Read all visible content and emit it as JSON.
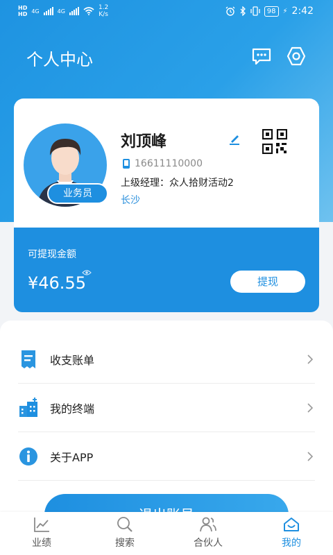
{
  "status_bar": {
    "network_label_1": "HD",
    "network_label_2": "HD",
    "signal_1": "4G",
    "signal_2": "4G",
    "speed": "1.2",
    "speed_unit": "K/s",
    "battery": "98",
    "time": "2:42"
  },
  "header": {
    "title": "个人中心"
  },
  "profile": {
    "name": "刘顶峰",
    "phone": "16611110000",
    "manager": "上级经理：众人拾财活动2",
    "city": "长沙",
    "role": "业务员"
  },
  "wallet": {
    "label": "可提现金额",
    "amount": "¥46.55",
    "withdraw_label": "提现"
  },
  "menu": {
    "items": [
      {
        "label": "收支账单",
        "icon": "bill-icon"
      },
      {
        "label": "我的终端",
        "icon": "terminal-icon"
      },
      {
        "label": "关于APP",
        "icon": "info-icon"
      }
    ]
  },
  "logout": {
    "label": "退出账号"
  },
  "tabs": [
    {
      "label": "业绩",
      "icon": "chart-icon"
    },
    {
      "label": "搜索",
      "icon": "search-icon"
    },
    {
      "label": "合伙人",
      "icon": "partner-icon"
    },
    {
      "label": "我的",
      "icon": "home-icon",
      "active": true
    }
  ],
  "colors": {
    "primary": "#1e8fe0",
    "hero_start": "#1e93e1",
    "hero_end": "#6fc2ef"
  }
}
